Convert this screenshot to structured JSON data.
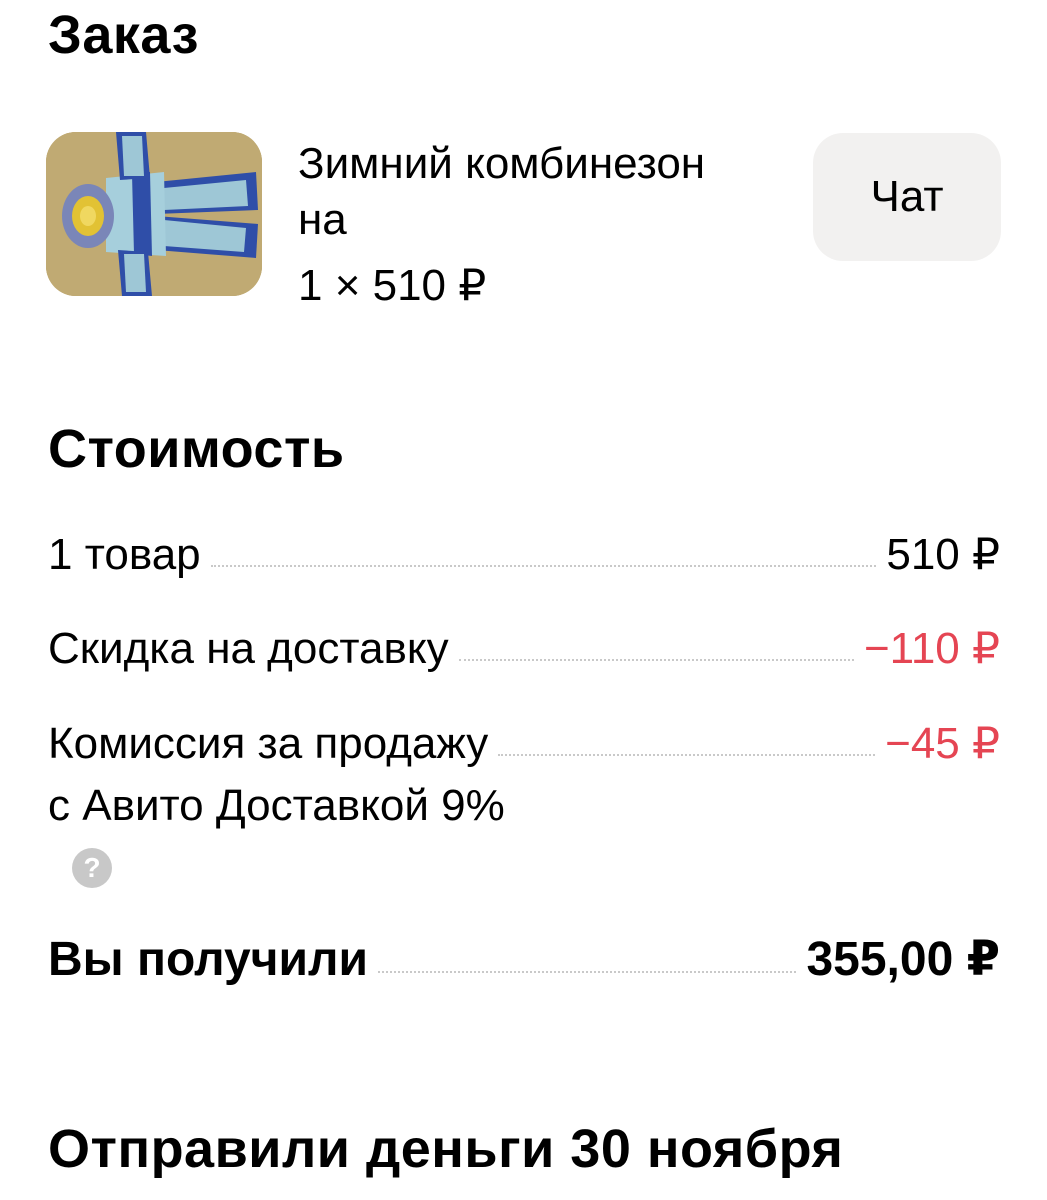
{
  "order": {
    "heading": "Заказ",
    "item_title": "Зимний комбинезон на",
    "item_qty_price": "1 × 510 ₽",
    "chat_label": "Чат"
  },
  "cost": {
    "heading": "Стоимость",
    "rows": [
      {
        "label": "1 товар",
        "value": "510 ₽"
      },
      {
        "label": "Скидка на доставку",
        "value": "−110 ₽"
      },
      {
        "label": "Комиссия за продажу",
        "label_cont": "с Авито Доставкой 9%",
        "value": "−45 ₽"
      }
    ],
    "help_icon": "question-circle-icon",
    "help_glyph": "?",
    "total_label": "Вы получили",
    "total_value": "355,00 ₽"
  },
  "payout": {
    "heading": "Отправили деньги 30 ноября"
  },
  "colors": {
    "negative": "#e54553",
    "button_bg": "#f2f1f0"
  }
}
